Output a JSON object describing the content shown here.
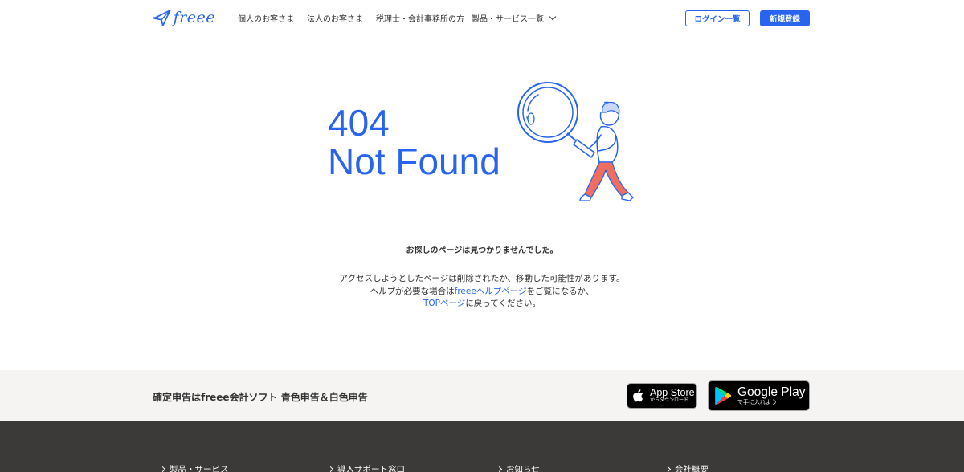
{
  "header": {
    "logo_text": "freee",
    "nav": [
      "個人のお客さま",
      "法人のお客さま",
      "税理士・会計事務所の方"
    ],
    "products_label": "製品・サービス一覧",
    "login_label": "ログイン一覧",
    "signup_label": "新規登録"
  },
  "error": {
    "code": "404",
    "title": "Not Found",
    "heading": "お探しのページは見つかりませんでした。",
    "line1": "アクセスしようとしたページは削除されたか、移動した可能性があります。",
    "line2_pre": "ヘルプが必要な場合は",
    "line2_link": "freeeヘルプページ",
    "line2_post": "をご覧になるか、",
    "line3_link": "TOPページ",
    "line3_post": "に戻ってください。"
  },
  "app_banner": {
    "text": "確定申告はfreee会計ソフト 青色申告＆白色申告",
    "apple_big": "App Store",
    "apple_small": "からダウンロード",
    "google_big": "Google Play",
    "google_small": "で手に入れよう"
  },
  "footer": {
    "links": [
      "製品・サービス",
      "導入サポート窓口",
      "お知らせ",
      "会社概要"
    ]
  },
  "colors": {
    "brand": "#2864f0",
    "footer_bg": "#3c3a38",
    "banner_bg": "#f5f4f3"
  }
}
